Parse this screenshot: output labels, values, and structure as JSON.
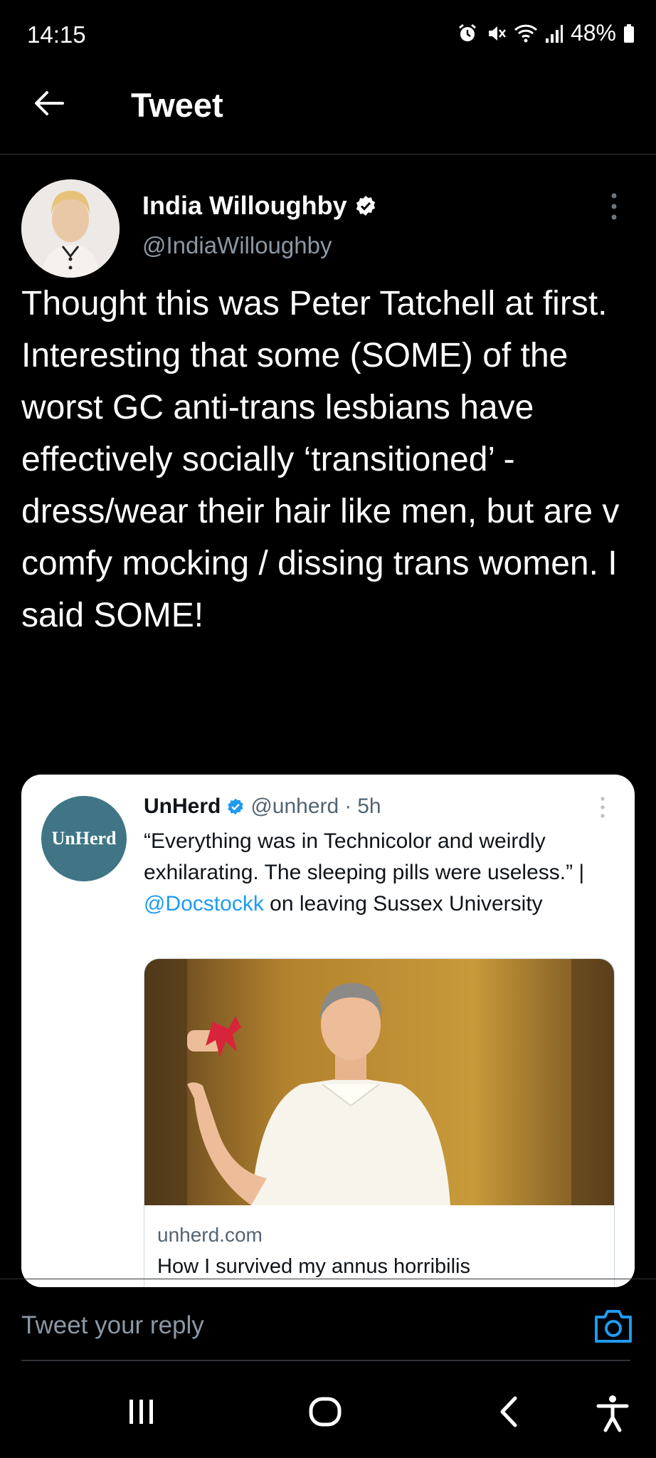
{
  "status_bar": {
    "time": "14:15",
    "battery": "48%"
  },
  "header": {
    "title": "Tweet"
  },
  "tweet": {
    "author_name": "India Willoughby",
    "author_handle": "@IndiaWilloughby",
    "text": "Thought this was Peter Tatchell at first.\nInteresting that some (SOME) of the worst GC anti-trans lesbians have effectively socially ‘transitioned’ - dress/wear their hair like men, but are v comfy mocking / dissing trans women. I said SOME!"
  },
  "quoted_tweet": {
    "author_name": "UnHerd",
    "author_handle": "@unherd",
    "separator": "·",
    "time": "5h",
    "avatar_text": "UnHerd",
    "text_before_mention": "“Everything was in Technicolor and weirdly exhilarating. The sleeping pills were useless.” | ",
    "mention": "@Docstockk",
    "text_after_mention": " on leaving Sussex University",
    "link_domain": "unherd.com",
    "link_title": "How I survived my annus horribilis"
  },
  "reply": {
    "placeholder": "Tweet your reply"
  },
  "colors": {
    "background": "#000000",
    "accent": "#1d9bf0",
    "secondary_text": "#8b98a5"
  },
  "icons": [
    "back-arrow-icon",
    "verified-icon",
    "more-icon",
    "camera-icon",
    "recents-icon",
    "home-icon",
    "back-icon",
    "accessibility-icon",
    "alarm-icon",
    "mute-icon",
    "wifi-icon",
    "signal-icon",
    "battery-icon"
  ]
}
